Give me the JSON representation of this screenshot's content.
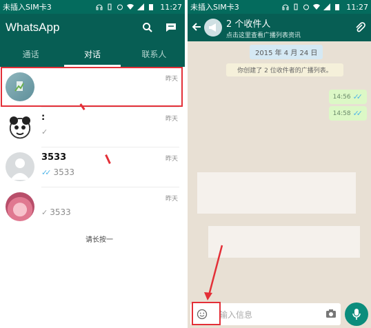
{
  "status_bar": {
    "carrier": "未插入SIM卡3",
    "time": "11:27"
  },
  "left_screen": {
    "app_title": "WhatsApp",
    "tabs": [
      {
        "label": "通话",
        "active": false
      },
      {
        "label": "对话",
        "active": true
      },
      {
        "label": "联系人",
        "active": false
      }
    ],
    "chats": [
      {
        "name": "",
        "preview": "",
        "time": "昨天",
        "avatar": "group-broadcast-avatar",
        "tick": ""
      },
      {
        "name": ":",
        "preview": "",
        "time": "昨天",
        "avatar": "panda-avatar",
        "tick": "single-grey"
      },
      {
        "name": "3533",
        "preview": "3533",
        "time": "昨天",
        "avatar": "default-avatar",
        "tick": "double-blue"
      },
      {
        "name": "",
        "preview": "3533",
        "time": "昨天",
        "avatar": "flower-avatar",
        "tick": "single-grey"
      }
    ],
    "hint": "请长按一"
  },
  "right_screen": {
    "title": "2 个收件人",
    "subtitle": "点击这里查看广播列表资讯",
    "date_pill": "2015 年 4 月 24 日",
    "system_note": "你创建了 2 位收件者的广播列表。",
    "messages": [
      {
        "time": "14:56",
        "tick": "double-blue"
      },
      {
        "time": "14:58",
        "tick": "double-blue"
      }
    ],
    "input_placeholder": "输入信息"
  },
  "colors": {
    "header": "#075e54",
    "status_bar": "#046b5d",
    "accent": "#0b8d7c",
    "annotation_red": "#e32f37",
    "outgoing_bubble": "#dcf8c6",
    "chat_background": "#e8e0d4"
  }
}
